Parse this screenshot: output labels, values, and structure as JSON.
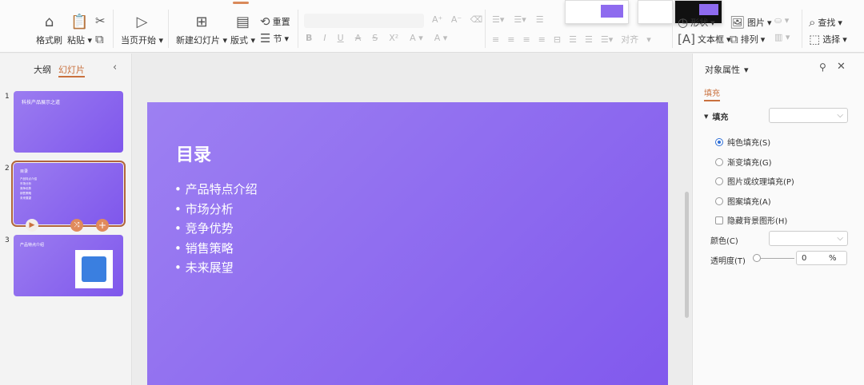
{
  "toolbar": {
    "format_painter": "格式刷",
    "paste": "粘贴",
    "start_from_current": "当页开始",
    "new_slide": "新建幻灯片",
    "layout": "版式",
    "reset": "重置",
    "section": "节",
    "align": "对齐",
    "shape": "形状",
    "picture": "图片",
    "textbox": "文本框",
    "arrange": "排列",
    "find": "查找",
    "select": "选择",
    "bold": "B",
    "italic": "I",
    "underline": "U",
    "strike": "S",
    "superscript": "X²"
  },
  "left_panel": {
    "tabs": [
      "大纲",
      "幻灯片"
    ],
    "active_tab": "幻灯片",
    "slides": [
      {
        "num": "1",
        "title": "科技产品展示之道"
      },
      {
        "num": "2",
        "title": "目录",
        "selected": true
      },
      {
        "num": "3",
        "title": "产品特点介绍"
      }
    ]
  },
  "slide": {
    "title": "目录",
    "bullets": [
      "产品特点介绍",
      "市场分析",
      "竞争优势",
      "销售策略",
      "未来展望"
    ]
  },
  "right_panel": {
    "title": "对象属性",
    "tab": "填充",
    "section": "填充",
    "options": [
      "纯色填充(S)",
      "渐变填充(G)",
      "图片或纹理填充(P)",
      "图案填充(A)"
    ],
    "selected_option": "纯色填充(S)",
    "hide_bg": "隐藏背景图形(H)",
    "color_label": "颜色(C)",
    "transparency_label": "透明度(T)",
    "transparency_value": "0",
    "percent": "%"
  },
  "colors": {
    "accent": "#d9895a",
    "slide": "#8e6bef"
  }
}
